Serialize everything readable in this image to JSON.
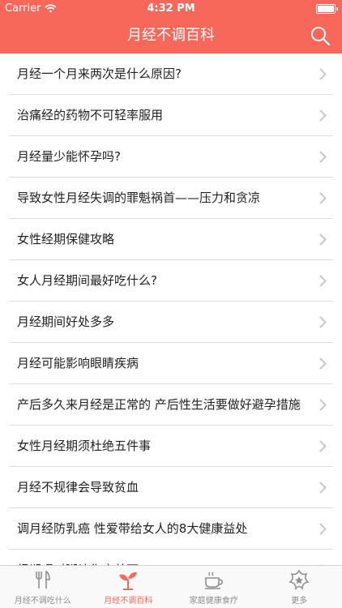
{
  "status_bar": {
    "carrier": "Carrier",
    "time": "4:32 PM",
    "battery_level": 1.0
  },
  "nav": {
    "title": "月经不调百科",
    "search_icon": "search-icon"
  },
  "articles": [
    "月经一个月来两次是什么原因?",
    "治痛经的药物不可轻率服用",
    "月经量少能怀孕吗?",
    "导致女性月经失调的罪魁祸首——压力和贪凉",
    "女性经期保健攻略",
    "女人月经期间最好吃什么?",
    "月经期间好处多多",
    "月经可能影响眼睛疾病",
    "产后多久来月经是正常的 产后性生活要做好避孕措施",
    "女性月经期须杜绝五件事",
    "月经不规律会导致贫血",
    "调月经防乳癌 性爱带给女人的8大健康益处",
    "经期喝对粥让你变美丽"
  ],
  "tabs": [
    {
      "label": "月经不调吃什么",
      "icon": "fork-knife-icon",
      "active": false
    },
    {
      "label": "月经不调百科",
      "icon": "sprout-icon",
      "active": true
    },
    {
      "label": "家庭健康食疗",
      "icon": "tea-cup-icon",
      "active": false
    },
    {
      "label": "更多",
      "icon": "star-flower-icon",
      "active": false
    }
  ],
  "colors": {
    "accent": "#f8685a",
    "tab_inactive": "#8e8e8e",
    "separator": "#dedede"
  }
}
